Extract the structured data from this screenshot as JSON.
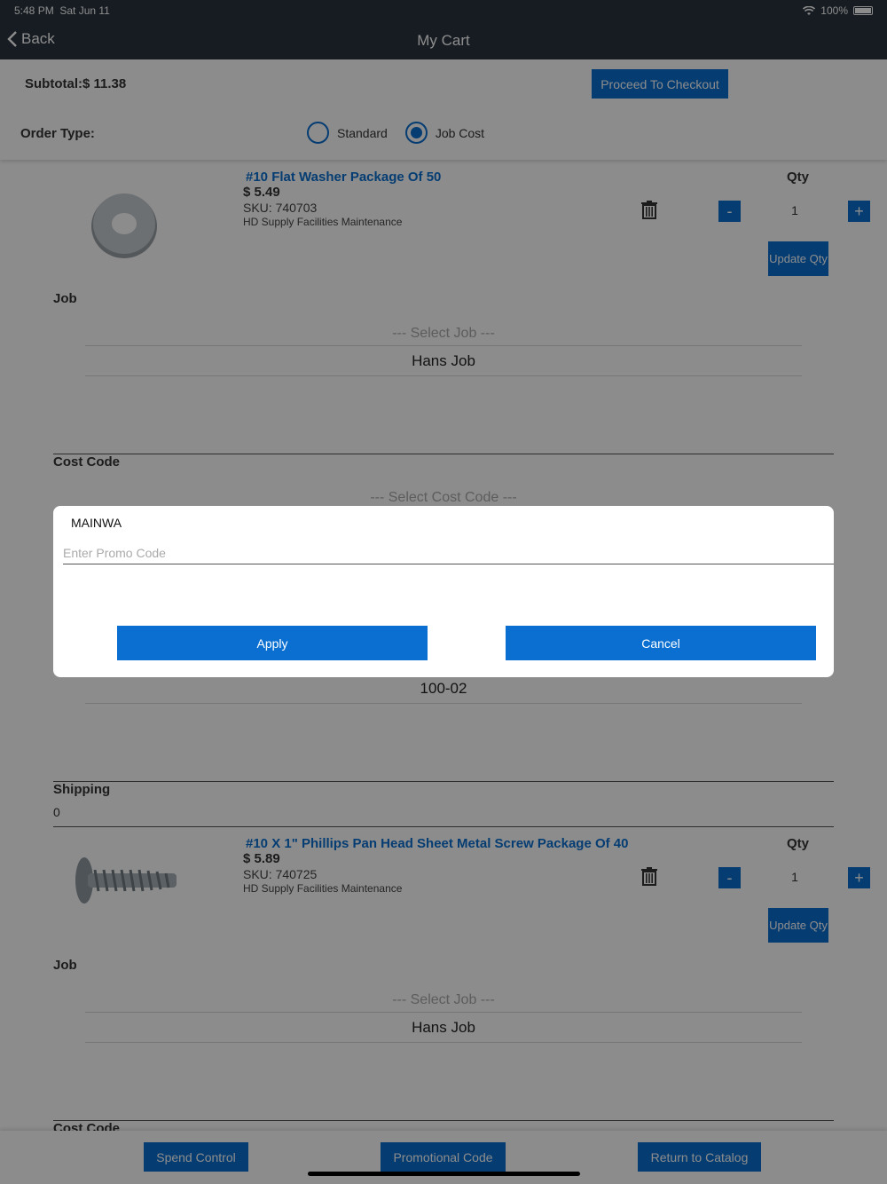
{
  "status_bar": {
    "time": "5:48 PM",
    "date": "Sat Jun 11",
    "battery": "100%"
  },
  "nav": {
    "back_label": "Back",
    "title": "My Cart"
  },
  "header": {
    "subtotal": "Subtotal:$ 11.38",
    "checkout_label": "Proceed To Checkout",
    "order_type_label": "Order Type:",
    "options": [
      {
        "label": "Standard",
        "selected": false
      },
      {
        "label": "Job Cost",
        "selected": true
      }
    ]
  },
  "items": [
    {
      "name": "#10 Flat Washer Package Of 50",
      "price": "$ 5.49",
      "sku": "SKU: 740703",
      "vendor": "HD Supply Facilities Maintenance",
      "qty_label": "Qty",
      "qty": "1",
      "minus": "-",
      "plus": "+",
      "update_label": "Update Qty",
      "job_label": "Job",
      "job_placeholder": "--- Select Job ---",
      "job_selected": "Hans Job",
      "cost_code_label": "Cost Code",
      "cost_code_placeholder": "--- Select Cost Code ---",
      "cost_code_selected": "100-02",
      "shipping_label": "Shipping",
      "shipping_value": "0"
    },
    {
      "name": "#10 X 1\" Phillips Pan Head Sheet Metal Screw Package Of 40",
      "price": "$ 5.89",
      "sku": "SKU: 740725",
      "vendor": "HD Supply Facilities Maintenance",
      "qty_label": "Qty",
      "qty": "1",
      "minus": "-",
      "plus": "+",
      "update_label": "Update Qty",
      "job_label": "Job",
      "job_placeholder": "--- Select Job ---",
      "job_selected": "Hans Job",
      "cost_code_label": "Cost Code"
    }
  ],
  "footer": {
    "spend_control": "Spend Control",
    "promo_code": "Promotional Code",
    "return_catalog": "Return to Catalog"
  },
  "modal": {
    "title": "MAINWA",
    "placeholder": "Enter Promo Code",
    "value": "",
    "apply_label": "Apply",
    "cancel_label": "Cancel"
  },
  "colors": {
    "accent": "#0a6fd1",
    "navbar": "#2a343f"
  }
}
